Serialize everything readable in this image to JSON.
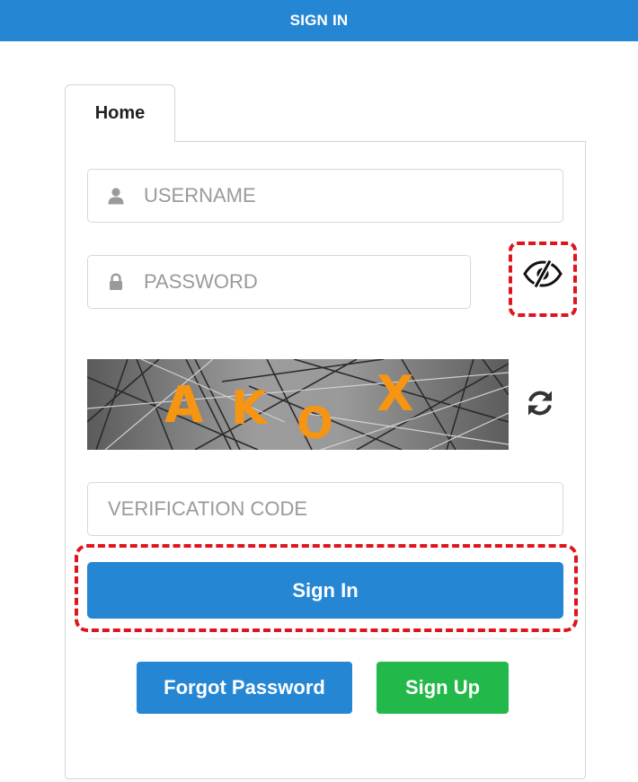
{
  "header": {
    "title": "SIGN IN"
  },
  "tabs": [
    {
      "label": "Home"
    }
  ],
  "form": {
    "username": {
      "placeholder": "USERNAME",
      "value": ""
    },
    "password": {
      "placeholder": "PASSWORD",
      "value": ""
    },
    "verification": {
      "placeholder": "VERIFICATION CODE",
      "value": ""
    },
    "captcha": {
      "text": "AKOX",
      "chars": [
        "A",
        "K",
        "O",
        "X"
      ],
      "char_color": "#f59512"
    },
    "sign_in_label": "Sign In",
    "forgot_label": "Forgot Password",
    "sign_up_label": "Sign Up"
  },
  "icons": {
    "username": "user-icon",
    "password": "lock-icon",
    "toggle_password": "eye-slash-icon",
    "refresh_captcha": "refresh-icon"
  },
  "colors": {
    "primary": "#2586d4",
    "success": "#22b94a",
    "highlight": "#e0141e"
  }
}
